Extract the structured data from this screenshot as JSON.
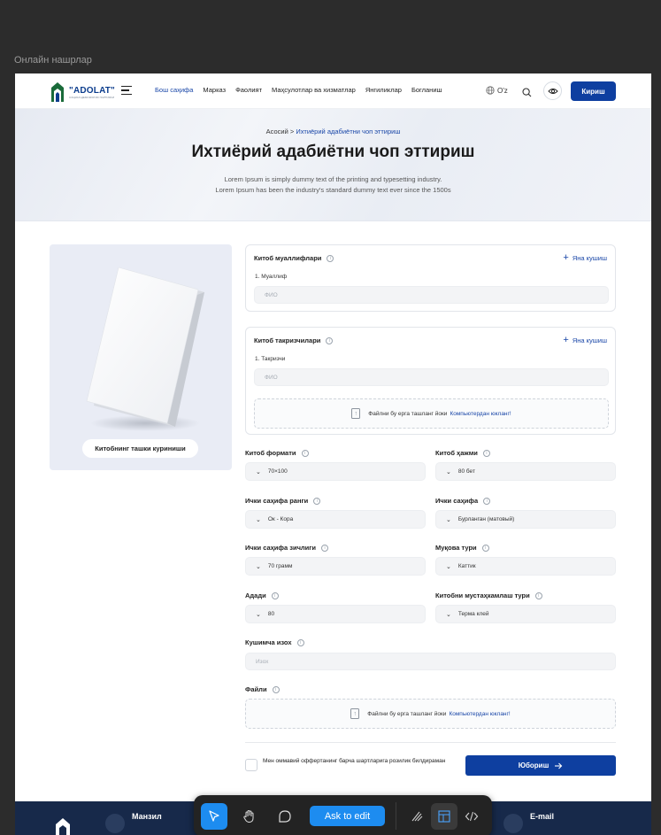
{
  "frame_label": "Онлайн нашрлар",
  "header": {
    "logo_name": "\"ADOLAT\"",
    "logo_sub": "СОЦИАЛ-ДЕМОКРАТИК ПАРТИЯСИ",
    "nav": [
      "Бош саҳифа",
      "Марказ",
      "Фаолият",
      "Маҳсулотлар ва хизматлар",
      "Янгиликлар",
      "Богланиш"
    ],
    "lang": "O'z",
    "login_label": "Кириш"
  },
  "hero": {
    "breadcrumb_home": "Асосий >",
    "breadcrumb_current": "Ихтиёрий адабиётни чоп эттириш",
    "title": "Ихтиёрий адабиётни чоп эттириш",
    "desc_line1": "Lorem Ipsum is simply dummy text of the printing and typesetting industry.",
    "desc_line2": "Lorem Ipsum has been the industry's standard dummy text ever since the 1500s"
  },
  "cover": {
    "label": "Китобнинг ташки куриниши"
  },
  "authors": {
    "title": "Китоб муаллифлари",
    "add_label": "Яна кушиш",
    "item_label": "1. Муаллиф",
    "placeholder": "ФИО"
  },
  "reviewers": {
    "title": "Китоб такризчилари",
    "add_label": "Яна кушиш",
    "item_label": "1. Такризчи",
    "placeholder": "ФИО",
    "drop_text": "Файлни бу ерга ташланг йоки",
    "drop_link": "Компьютердан юкланг!"
  },
  "fields": {
    "format": {
      "label": "Китоб формати",
      "value": "70×100"
    },
    "volume": {
      "label": "Китоб ҳажми",
      "value": "80 бет"
    },
    "inner_color": {
      "label": "Ички саҳифа ранги",
      "value": "Ок - Кора"
    },
    "inner_page": {
      "label": "Ички саҳифа",
      "value": "Бурланган (матовый)"
    },
    "density": {
      "label": "Ички саҳифа зичлиги",
      "value": "70 грамм"
    },
    "binding": {
      "label": "Муқова тури",
      "value": "Каттик"
    },
    "copies": {
      "label": "Адади",
      "value": "80"
    },
    "fastening": {
      "label": "Китобни мустаҳкамлаш тури",
      "value": "Терма клей"
    }
  },
  "comment": {
    "label": "Кушимча изох",
    "placeholder": "Изох"
  },
  "files": {
    "label": "Файли",
    "drop_text": "Файлни бу ерга ташланг йоки",
    "drop_link": "Компьютердан юкланг!"
  },
  "agree_text": "Мен оммавий оффертанинг барча шартларига розилик билдираман",
  "submit_label": "Юбориш",
  "footer": {
    "address_title": "Манзил",
    "email_title": "E-mail"
  },
  "toolbar": {
    "ask_label": "Ask to edit"
  },
  "colors": {
    "primary": "#0e3fa0",
    "link": "#1a47a8",
    "footer": "#17294a",
    "toolbar_accent": "#1d8cf0"
  }
}
